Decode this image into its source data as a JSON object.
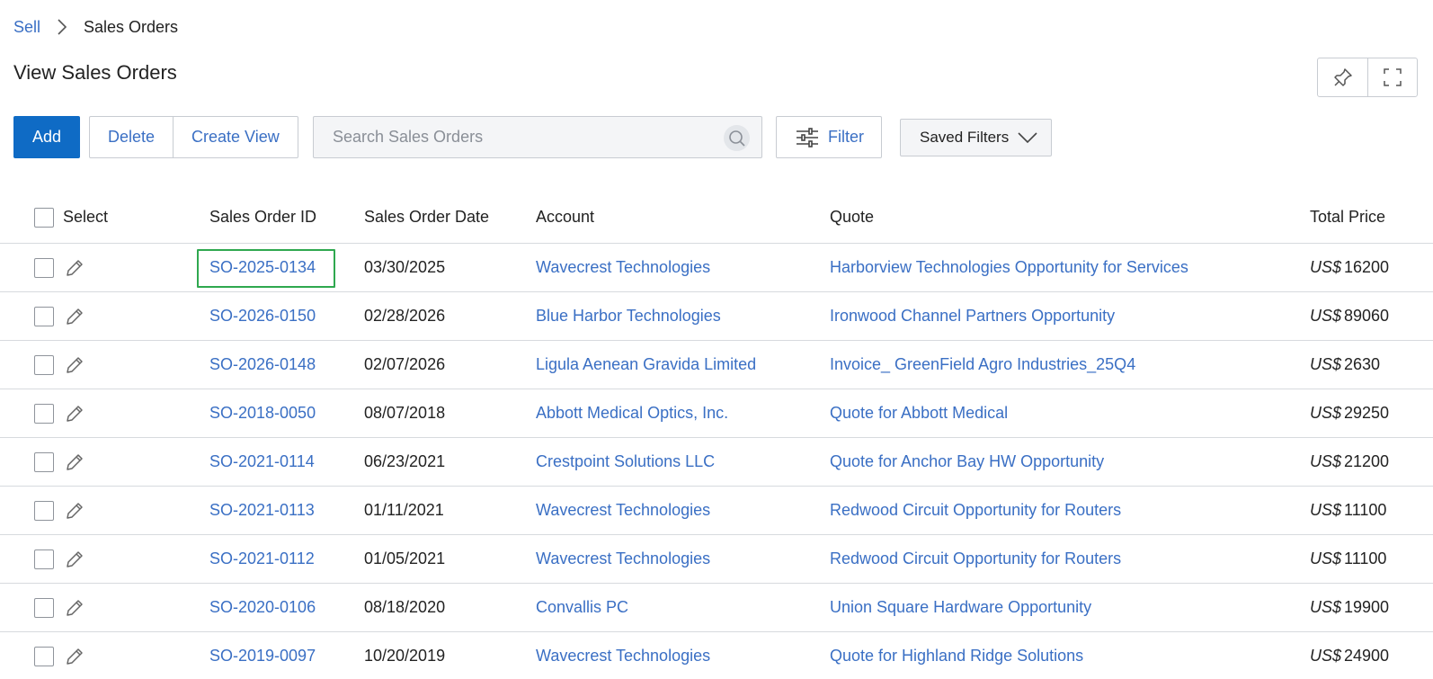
{
  "breadcrumb": {
    "root": "Sell",
    "current": "Sales Orders"
  },
  "page": {
    "title": "View Sales Orders"
  },
  "toolbar": {
    "add_label": "Add",
    "delete_label": "Delete",
    "create_view_label": "Create View",
    "search_placeholder": "Search Sales Orders",
    "filter_label": "Filter",
    "saved_filters_label": "Saved Filters"
  },
  "table": {
    "columns": {
      "select": "Select",
      "id": "Sales Order ID",
      "date": "Sales Order Date",
      "account": "Account",
      "quote": "Quote",
      "price": "Total Price"
    },
    "currency_prefix": "US$",
    "rows": [
      {
        "id": "SO-2025-0134",
        "date": "03/30/2025",
        "account": "Wavecrest Technologies",
        "quote": "Harborview Technologies Opportunity for Services",
        "price": "16200"
      },
      {
        "id": "SO-2026-0150",
        "date": "02/28/2026",
        "account": "Blue Harbor Technologies",
        "quote": "Ironwood Channel Partners Opportunity",
        "price": "89060"
      },
      {
        "id": "SO-2026-0148",
        "date": "02/07/2026",
        "account": "Ligula Aenean Gravida Limited",
        "quote": "Invoice_ GreenField Agro Industries_25Q4",
        "price": "2630"
      },
      {
        "id": "SO-2018-0050",
        "date": "08/07/2018",
        "account": "Abbott Medical Optics, Inc.",
        "quote": "Quote for Abbott Medical",
        "price": "29250"
      },
      {
        "id": "SO-2021-0114",
        "date": "06/23/2021",
        "account": "Crestpoint Solutions LLC",
        "quote": "Quote for Anchor Bay HW Opportunity",
        "price": "21200"
      },
      {
        "id": "SO-2021-0113",
        "date": "01/11/2021",
        "account": "Wavecrest Technologies",
        "quote": "Redwood Circuit Opportunity for Routers",
        "price": "11100"
      },
      {
        "id": "SO-2021-0112",
        "date": "01/05/2021",
        "account": "Wavecrest Technologies",
        "quote": "Redwood Circuit Opportunity for Routers",
        "price": "11100"
      },
      {
        "id": "SO-2020-0106",
        "date": "08/18/2020",
        "account": "Convallis PC",
        "quote": "Union Square Hardware Opportunity",
        "price": "19900"
      },
      {
        "id": "SO-2019-0097",
        "date": "10/20/2019",
        "account": "Wavecrest Technologies",
        "quote": "Quote for Highland Ridge Solutions",
        "price": "24900"
      }
    ]
  },
  "colors": {
    "primary": "#0f6bc5",
    "link": "#3a6fc4",
    "highlight": "#2fa84f",
    "border": "#c8ccd2"
  },
  "icons": {
    "breadcrumb_separator": "chevron-right-icon",
    "pin": "pin-icon",
    "fullscreen": "fullscreen-icon",
    "search": "search-icon",
    "filter": "sliders-icon",
    "dropdown": "chevron-down-icon",
    "edit": "pencil-icon"
  }
}
